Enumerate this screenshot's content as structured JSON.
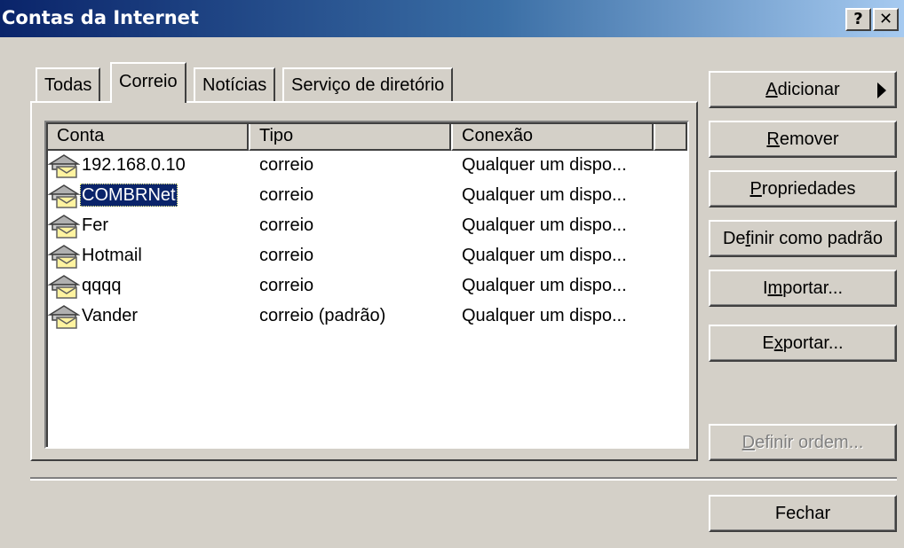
{
  "window": {
    "title": "Contas da Internet",
    "help_button": "?",
    "close_button": "✕"
  },
  "tabs": [
    {
      "label": "Todas",
      "active": false
    },
    {
      "label": "Correio",
      "active": true
    },
    {
      "label": "Notícias",
      "active": false
    },
    {
      "label": "Serviço de diretório",
      "active": false
    }
  ],
  "list": {
    "columns": [
      "Conta",
      "Tipo",
      "Conexão"
    ],
    "rows": [
      {
        "account": "192.168.0.10",
        "type": "correio",
        "connection": "Qualquer um dispo...",
        "selected": false
      },
      {
        "account": "COMBRNet",
        "type": "correio",
        "connection": "Qualquer um dispo...",
        "selected": true
      },
      {
        "account": "Fer",
        "type": "correio",
        "connection": "Qualquer um dispo...",
        "selected": false
      },
      {
        "account": "Hotmail",
        "type": "correio",
        "connection": "Qualquer um dispo...",
        "selected": false
      },
      {
        "account": "qqqq",
        "type": "correio",
        "connection": "Qualquer um dispo...",
        "selected": false
      },
      {
        "account": "Vander",
        "type": "correio (padrão)",
        "connection": "Qualquer um dispo...",
        "selected": false
      }
    ]
  },
  "buttons": {
    "add": {
      "label": "Adicionar",
      "mnemonic": "A"
    },
    "remove": {
      "label": "Remover",
      "mnemonic": "R"
    },
    "properties": {
      "label": "Propriedades",
      "mnemonic": "P"
    },
    "set_default": {
      "label": "Definir como padrão",
      "mnemonic": "f"
    },
    "import": {
      "label": "Importar...",
      "mnemonic": "m"
    },
    "export": {
      "label": "Exportar...",
      "mnemonic": "x"
    },
    "set_order": {
      "label": "Definir ordem...",
      "mnemonic": "D",
      "disabled": true
    },
    "close": {
      "label": "Fechar"
    }
  },
  "icons": {
    "account": "mail-account-icon",
    "add_arrow": "arrow-right-icon"
  },
  "colors": {
    "title_start": "#0a246a",
    "title_end": "#a6caf0",
    "face": "#d4d0c8",
    "selection": "#0a246a"
  }
}
